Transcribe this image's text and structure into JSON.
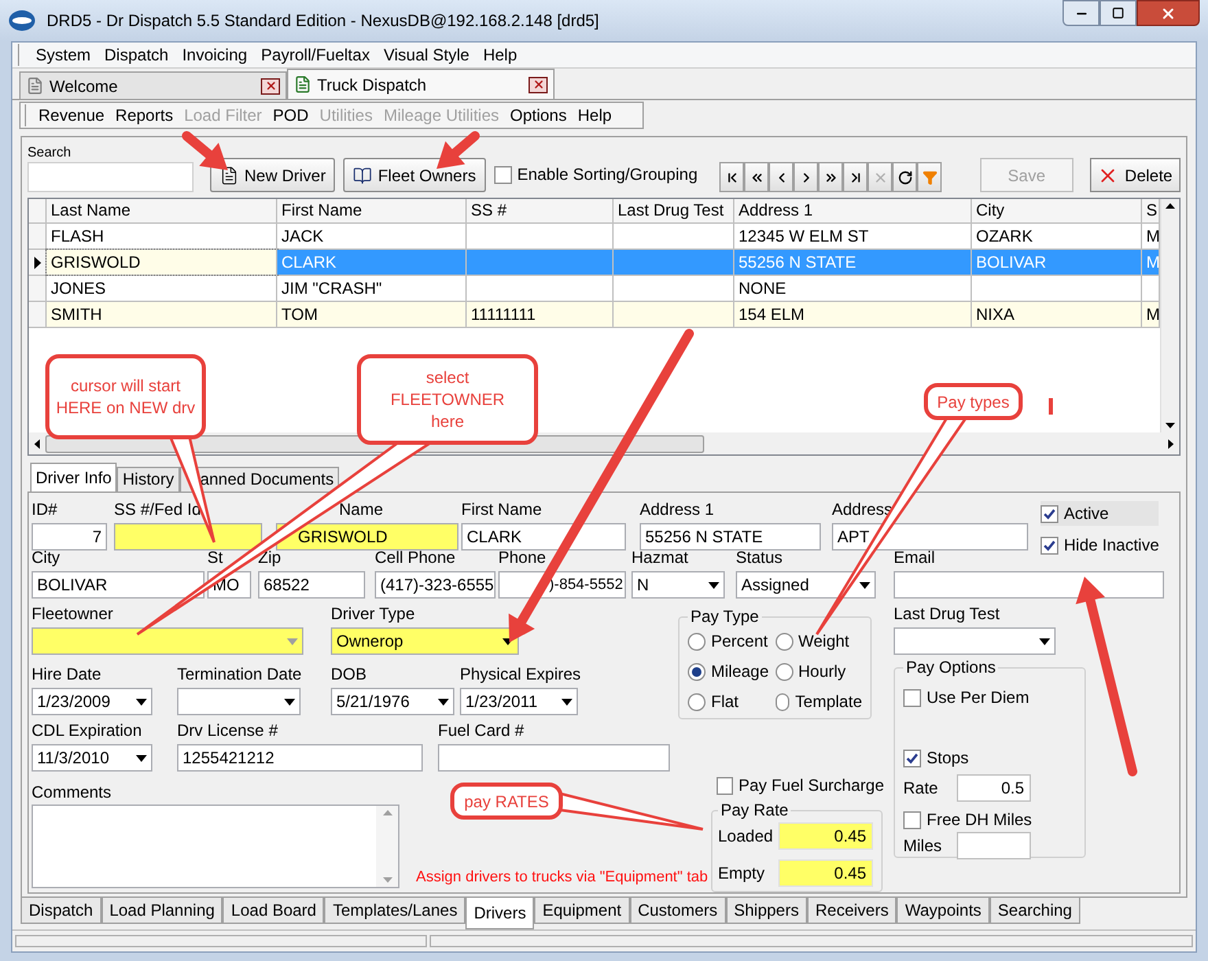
{
  "window": {
    "title": "DRD5 - Dr Dispatch 5.5 Standard Edition - NexusDB@192.168.2.148 [drd5]"
  },
  "menu": [
    "System",
    "Dispatch",
    "Invoicing",
    "Payroll/Fueltax",
    "Visual Style",
    "Help"
  ],
  "document_tabs": [
    {
      "label": "Welcome",
      "selected": false
    },
    {
      "label": "Truck Dispatch",
      "selected": true
    }
  ],
  "submenu": [
    {
      "label": "Revenue",
      "disabled": false
    },
    {
      "label": "Reports",
      "disabled": false
    },
    {
      "label": "Load Filter",
      "disabled": true
    },
    {
      "label": "POD",
      "disabled": false
    },
    {
      "label": "Utilities",
      "disabled": true
    },
    {
      "label": "Mileage Utilities",
      "disabled": true
    },
    {
      "label": "Options",
      "disabled": false
    },
    {
      "label": "Help",
      "disabled": false
    }
  ],
  "toolbar": {
    "search": {
      "label": "Search"
    },
    "new_driver": "New Driver",
    "fleet_owners": "Fleet Owners",
    "sorting": {
      "label": "Enable Sorting/Grouping",
      "checked": false
    },
    "nav_buttons": [
      {
        "kind": "first",
        "disabled": false
      },
      {
        "kind": "prior-page",
        "disabled": false
      },
      {
        "kind": "prior",
        "disabled": false
      },
      {
        "kind": "next",
        "disabled": false
      },
      {
        "kind": "next-page",
        "disabled": false
      },
      {
        "kind": "last",
        "disabled": false
      },
      {
        "kind": "cancel",
        "disabled": true
      },
      {
        "kind": "refresh",
        "disabled": false
      },
      {
        "kind": "filter",
        "disabled": false
      }
    ],
    "save": {
      "label": "Save",
      "disabled": true
    },
    "delete": {
      "label": "Delete",
      "disabled": false
    }
  },
  "grid": {
    "columns": [
      "Last Name",
      "First Name",
      "SS #",
      "Last Drug Test",
      "Address 1",
      "City",
      "S"
    ],
    "rows": [
      {
        "cells": [
          "FLASH",
          "JACK",
          "",
          "",
          "12345 W ELM ST",
          "OZARK",
          "M"
        ],
        "selected": false
      },
      {
        "cells": [
          "GRISWOLD",
          "CLARK",
          "",
          "",
          "55256 N STATE",
          "BOLIVAR",
          "M"
        ],
        "selected": true
      },
      {
        "cells": [
          "JONES",
          "JIM \"CRASH\"",
          "",
          "",
          "NONE",
          "",
          ""
        ],
        "selected": false
      },
      {
        "cells": [
          "SMITH",
          "TOM",
          "11111111",
          "",
          "154 ELM",
          "NIXA",
          "M"
        ],
        "selected": false
      }
    ]
  },
  "detail_tabs": [
    {
      "label": "Driver Info",
      "selected": true
    },
    {
      "label": "History",
      "selected": false
    },
    {
      "label": "anned Documents",
      "selected": false
    }
  ],
  "form": {
    "id": {
      "label": "ID#",
      "value": "7",
      "highlighted": false
    },
    "ss": {
      "label": "SS #/Fed Id",
      "highlighted": true
    },
    "last_name": {
      "label": "Name",
      "value": "GRISWOLD",
      "highlighted": true
    },
    "first_name": {
      "label": "First Name",
      "value": "CLARK",
      "highlighted": false
    },
    "address1": {
      "label": "Address 1",
      "value": "55256 N STATE",
      "highlighted": false
    },
    "address2": {
      "label": "Address",
      "value": "APT",
      "highlighted": false
    },
    "active": {
      "label": "Active",
      "checked": true
    },
    "hide_inactive": {
      "label": "Hide Inactive",
      "checked": true
    },
    "city": {
      "label": "City",
      "value": "BOLIVAR",
      "highlighted": false
    },
    "state": {
      "label": "St",
      "value": "MO",
      "highlighted": false
    },
    "zip": {
      "label": "Zip",
      "value": "68522",
      "highlighted": false
    },
    "cell_phone": {
      "label": "Cell Phone",
      "value": "(417)-323-6555",
      "highlighted": false
    },
    "phone2": {
      "label": "Phone",
      "value": ")-854-5552",
      "highlighted": false
    },
    "hazmat": {
      "label": "Hazmat",
      "value": "N",
      "highlighted": false
    },
    "status": {
      "label": "Status",
      "value": "Assigned",
      "highlighted": false
    },
    "email": {
      "label": "Email",
      "highlighted": false
    },
    "fleetowner": {
      "label": "Fleetowner",
      "highlighted": true
    },
    "driver_type": {
      "label": "Driver Type",
      "value": "Ownerop",
      "highlighted": true
    },
    "hire_date": {
      "label": "Hire Date",
      "value": "1/23/2009",
      "highlighted": false
    },
    "termination_date": {
      "label": "Termination Date",
      "highlighted": false
    },
    "dob": {
      "label": "DOB",
      "value": "5/21/1976",
      "highlighted": false
    },
    "physical_expires": {
      "label": "Physical Expires",
      "value": "1/23/2011",
      "highlighted": false
    },
    "cdl_expiration": {
      "label": "CDL Expiration",
      "value": "11/3/2010",
      "highlighted": false
    },
    "drv_license": {
      "label": "Drv License #",
      "value": "1255421212",
      "highlighted": false
    },
    "fuel_card": {
      "label": "Fuel Card #",
      "highlighted": false
    },
    "comments": {
      "label": "Comments"
    },
    "last_drug_test": {
      "label": "Last Drug Test",
      "highlighted": false
    },
    "pay_type": {
      "title": "Pay Type",
      "options": [
        {
          "label": "Percent",
          "selected": false
        },
        {
          "label": "Weight",
          "selected": false
        },
        {
          "label": "Mileage",
          "selected": true
        },
        {
          "label": "Hourly",
          "selected": false
        },
        {
          "label": "Flat",
          "selected": false
        },
        {
          "label": "Template",
          "selected": false
        }
      ]
    },
    "pay_options": {
      "title": "Pay Options",
      "use_per_diem": {
        "label": "Use Per Diem",
        "checked": false
      },
      "stops": {
        "label": "Stops",
        "checked": true
      },
      "rate": {
        "label": "Rate",
        "value": "0.5"
      },
      "free_dh_miles": {
        "label": "Free DH Miles",
        "checked": false
      },
      "miles": {
        "label": "Miles"
      }
    },
    "pay_fuel_surcharge": {
      "label": "Pay Fuel Surcharge",
      "checked": false
    },
    "pay_rate": {
      "title": "Pay Rate",
      "loaded": {
        "label": "Loaded",
        "value": "0.45",
        "highlighted": true
      },
      "empty": {
        "label": "Empty",
        "value": "0.45",
        "highlighted": true
      }
    },
    "note": "Assign drivers to trucks via \"Equipment\" tab"
  },
  "module_tabs": [
    {
      "label": "Dispatch",
      "selected": false
    },
    {
      "label": "Load Planning",
      "selected": false
    },
    {
      "label": "Load Board",
      "selected": false
    },
    {
      "label": "Templates/Lanes",
      "selected": false
    },
    {
      "label": "Drivers",
      "selected": true
    },
    {
      "label": "Equipment",
      "selected": false
    },
    {
      "label": "Customers",
      "selected": false
    },
    {
      "label": "Shippers",
      "selected": false
    },
    {
      "label": "Receivers",
      "selected": false
    },
    {
      "label": "Waypoints",
      "selected": false
    },
    {
      "label": "Searching",
      "selected": false
    }
  ],
  "annotations": [
    {
      "text": "cursor will start HERE on NEW drv"
    },
    {
      "text": "select FLEETOWNER here"
    },
    {
      "text": "Pay types"
    },
    {
      "text": "pay RATES"
    }
  ]
}
